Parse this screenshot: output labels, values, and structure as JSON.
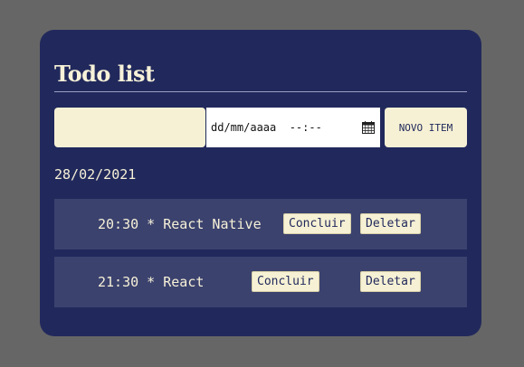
{
  "app": {
    "title": "Todo list"
  },
  "form": {
    "text_value": "",
    "date_placeholder": "dd/mm/aaaa  --:--",
    "new_item_label": "NOVO ITEM"
  },
  "list": {
    "date_heading": "28/02/2021",
    "items": [
      {
        "text": "20:30 * React Native",
        "complete_label": "Concluir",
        "delete_label": "Deletar"
      },
      {
        "text": "21:30 * React",
        "complete_label": "Concluir",
        "delete_label": "Deletar"
      }
    ]
  },
  "colors": {
    "page_background": "#666666",
    "card_background": "#21295c",
    "row_background": "#3b426e",
    "accent_cream": "#f6f1d4",
    "text_light": "#f7f1d8"
  },
  "icons": {
    "date_picker": "calendar-icon"
  }
}
